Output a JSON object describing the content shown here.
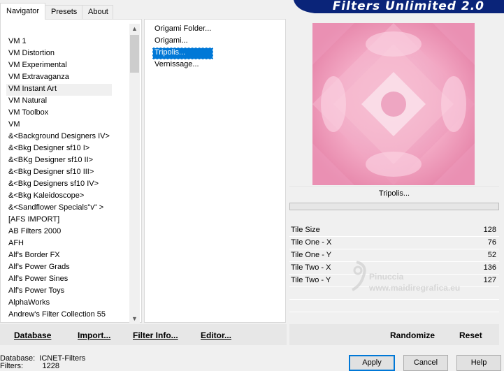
{
  "tabs": [
    {
      "label": "Navigator",
      "active": true
    },
    {
      "label": "Presets",
      "active": false
    },
    {
      "label": "About",
      "active": false
    }
  ],
  "banner": {
    "title": "Filters Unlimited 2.0",
    "color": "#0a2479"
  },
  "categories": [
    {
      "label": "VM 1",
      "selected": false
    },
    {
      "label": "VM Distortion",
      "selected": false
    },
    {
      "label": "VM Experimental",
      "selected": false
    },
    {
      "label": "VM Extravaganza",
      "selected": false
    },
    {
      "label": "VM Instant Art",
      "selected": true
    },
    {
      "label": "VM Natural",
      "selected": false
    },
    {
      "label": "VM Toolbox",
      "selected": false
    },
    {
      "label": "VM",
      "selected": false
    },
    {
      "label": "&<Background Designers IV>",
      "selected": false
    },
    {
      "label": "&<Bkg Designer sf10 I>",
      "selected": false
    },
    {
      "label": "&<BKg Designer sf10 II>",
      "selected": false
    },
    {
      "label": "&<Bkg Designer sf10 III>",
      "selected": false
    },
    {
      "label": "&<Bkg Designers sf10 IV>",
      "selected": false
    },
    {
      "label": "&<Bkg Kaleidoscope>",
      "selected": false
    },
    {
      "label": "&<Sandflower Specials\"v\" >",
      "selected": false
    },
    {
      "label": "[AFS IMPORT]",
      "selected": false
    },
    {
      "label": "AB Filters 2000",
      "selected": false
    },
    {
      "label": "AFH",
      "selected": false
    },
    {
      "label": "Alf's Border FX",
      "selected": false
    },
    {
      "label": "Alf's Power Grads",
      "selected": false
    },
    {
      "label": "Alf's Power Sines",
      "selected": false
    },
    {
      "label": "Alf's Power Toys",
      "selected": false
    },
    {
      "label": "AlphaWorks",
      "selected": false
    },
    {
      "label": "Andrew's Filter Collection 55",
      "selected": false
    }
  ],
  "filters": [
    {
      "label": "Origami Folder...",
      "selected": false
    },
    {
      "label": "Origami...",
      "selected": false
    },
    {
      "label": "Tripolis...",
      "selected": true
    },
    {
      "label": "Vernissage...",
      "selected": false
    }
  ],
  "preview": {
    "filter_name": "Tripolis..."
  },
  "params": [
    {
      "label": "Tile Size",
      "value": "128"
    },
    {
      "label": "Tile One - X",
      "value": "76"
    },
    {
      "label": "Tile One - Y",
      "value": "52"
    },
    {
      "label": "Tile Two - X",
      "value": "136"
    },
    {
      "label": "Tile Two - Y",
      "value": "127"
    }
  ],
  "watermark": {
    "line1": "Pinuccia",
    "line2": "www.maidiregrafica.eu"
  },
  "toolbar_left": {
    "database": "Database",
    "import": "Import...",
    "filter_info": "Filter Info...",
    "editor": "Editor..."
  },
  "toolbar_right": {
    "randomize": "Randomize",
    "reset": "Reset"
  },
  "status": {
    "database_label": "Database:",
    "database_value": "ICNET-Filters",
    "filters_label": "Filters:",
    "filters_value": "1228"
  },
  "buttons": {
    "apply": "Apply",
    "cancel": "Cancel",
    "help": "Help"
  },
  "colors": {
    "selection": "#0078d7",
    "banner": "#0a2479",
    "preview_pink": "#f0a0c0"
  }
}
